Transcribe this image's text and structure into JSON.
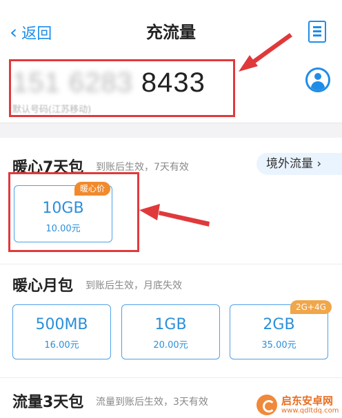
{
  "header": {
    "back_label": "返回",
    "title": "充流量"
  },
  "phone": {
    "masked": "151 6283",
    "visible": "8433",
    "carrier": "默认号码(江苏移动)"
  },
  "abroad_button": "境外流量",
  "sections": [
    {
      "title": "暖心7天包",
      "desc": "到账后生效，7天有效",
      "packages": [
        {
          "size": "10GB",
          "price": "10.00元",
          "badge": "暖心价"
        }
      ]
    },
    {
      "title": "暖心月包",
      "desc": "到账后生效，月底失效",
      "packages": [
        {
          "size": "500MB",
          "price": "16.00元"
        },
        {
          "size": "1GB",
          "price": "20.00元"
        },
        {
          "size": "2GB",
          "price": "35.00元",
          "badge": "2G+4G"
        }
      ]
    },
    {
      "title": "流量3天包",
      "desc": "流量到账后生效，3天有效"
    }
  ],
  "colors": {
    "accent": "#1f8de8",
    "annotation_red": "#e0393b",
    "badge_orange": "#f0893a"
  },
  "watermark": {
    "name": "启东安卓网",
    "url": "www.qdltdq.com"
  }
}
